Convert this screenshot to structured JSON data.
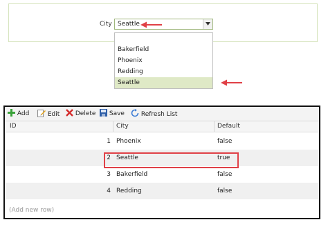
{
  "filter": {
    "label": "City",
    "selected_value": "Seattle"
  },
  "dropdown": {
    "options": [
      "Bakerfield",
      "Phoenix",
      "Redding",
      "Seattle"
    ],
    "highlighted": "Seattle"
  },
  "toolbar": {
    "add_label": "Add",
    "edit_label": "Edit",
    "delete_label": "Delete",
    "save_label": "Save",
    "refresh_label": "Refresh List"
  },
  "grid": {
    "columns": [
      "ID",
      "City",
      "Default"
    ],
    "rows": [
      {
        "id": "1",
        "city": "Phoenix",
        "default": "false"
      },
      {
        "id": "2",
        "city": "Seattle",
        "default": "true"
      },
      {
        "id": "3",
        "city": "Bakerfield",
        "default": "false"
      },
      {
        "id": "4",
        "city": "Redding",
        "default": "false"
      }
    ],
    "add_row_text": "(Add new row)"
  },
  "colors": {
    "annotation_red": "#e04046",
    "selection_green": "#dfe9c6",
    "panel_border": "#d6e4bd"
  }
}
